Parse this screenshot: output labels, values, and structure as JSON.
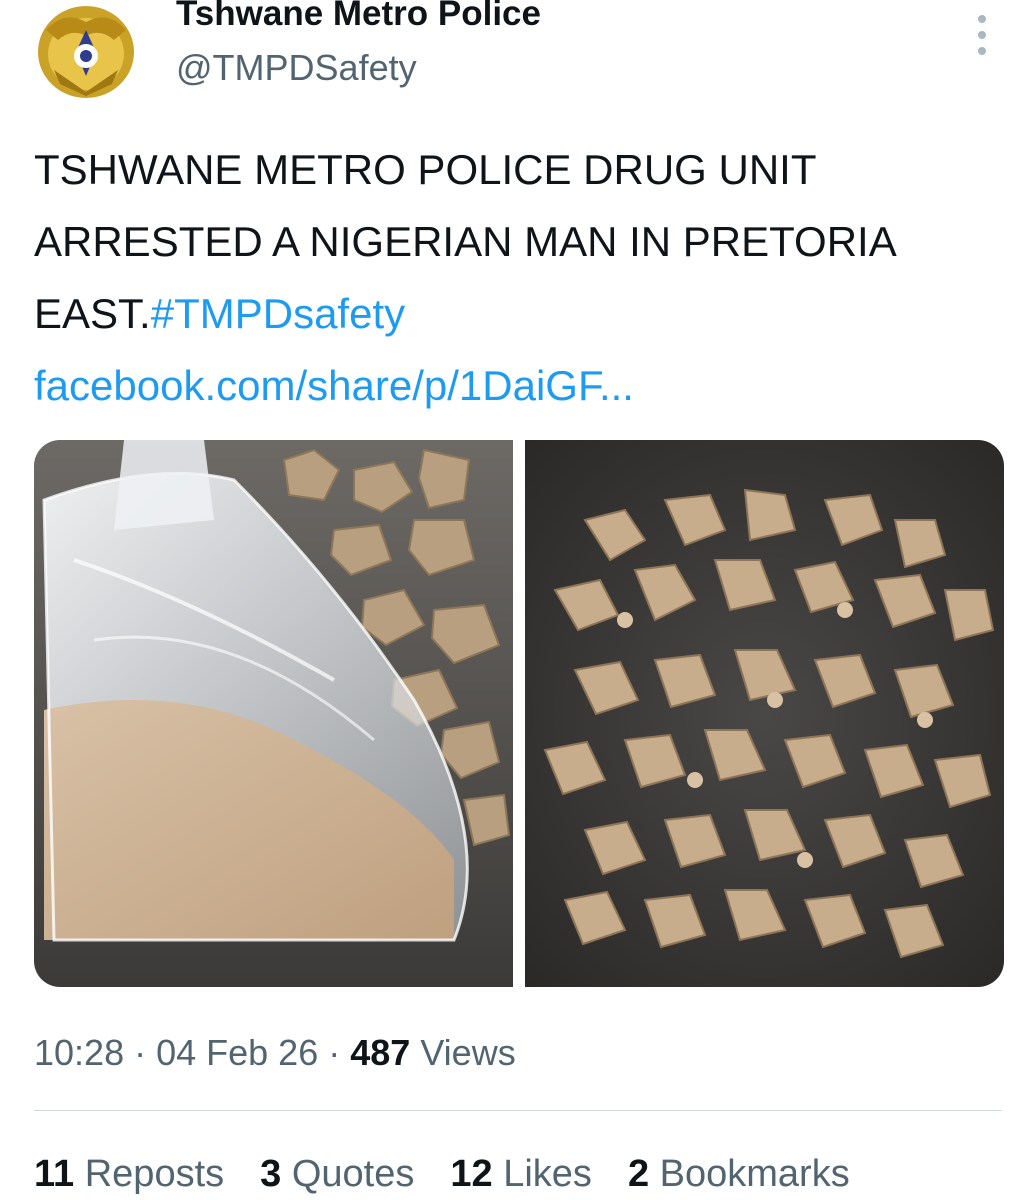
{
  "author": {
    "display_name": "Tshwane Metro Police",
    "handle": "@TMPDSafety",
    "avatar_icon": "police-badge-icon"
  },
  "tweet": {
    "text": "TSHWANE METRO POLICE DRUG UNIT ARRESTED A NIGERIAN MAN IN PRETORIA EAST.",
    "hashtag": "#TMPDsafety",
    "link": "facebook.com/share/p/1DaiGF..."
  },
  "meta": {
    "time": "10:28",
    "sep1": " · ",
    "date": "04 Feb 26",
    "sep2": " · ",
    "views_count": "487",
    "views_label": "Views"
  },
  "stats": [
    {
      "count": "11",
      "label": "Reposts"
    },
    {
      "count": "3",
      "label": "Quotes"
    },
    {
      "count": "12",
      "label": "Likes"
    },
    {
      "count": "2",
      "label": "Bookmarks"
    }
  ],
  "colors": {
    "link": "#1d9bf0",
    "secondary_text": "#536471",
    "primary_text": "#0f1419"
  }
}
